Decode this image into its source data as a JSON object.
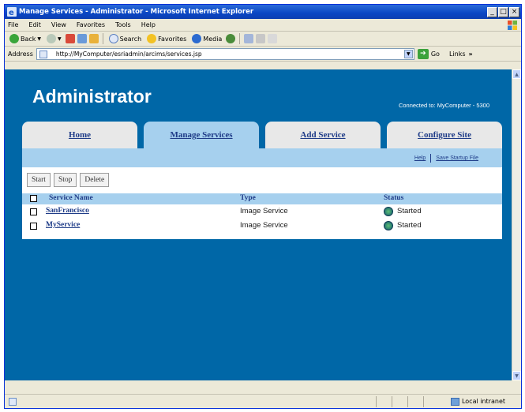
{
  "window": {
    "title": "Manage Services - Administrator - Microsoft Internet Explorer",
    "buttons": {
      "minimize": "_",
      "maximize": "□",
      "close": "×"
    }
  },
  "menu": [
    "File",
    "Edit",
    "View",
    "Favorites",
    "Tools",
    "Help"
  ],
  "toolbar": {
    "back": "Back",
    "search": "Search",
    "favorites": "Favorites",
    "media": "Media"
  },
  "address": {
    "label": "Address",
    "url": "http://MyComputer/esriadmin/arcims/services.jsp",
    "go": "Go",
    "links": "Links"
  },
  "page": {
    "title": "Administrator",
    "connected": "Connected to: MyComputer - 5300",
    "tabs": [
      "Home",
      "Manage Services",
      "Add Service",
      "Configure Site"
    ],
    "active_tab": "Manage Services",
    "sublinks": {
      "help": "Help",
      "save": "Save Startup File"
    },
    "actions": [
      "Start",
      "Stop",
      "Delete"
    ],
    "columns": {
      "name": "Service Name",
      "type": "Type",
      "status": "Status"
    },
    "services": [
      {
        "name": "SanFrancisco",
        "type": "Image Service",
        "status": "Started"
      },
      {
        "name": "MyService",
        "type": "Image Service",
        "status": "Started"
      }
    ]
  },
  "statusbar": {
    "zone": "Local intranet"
  },
  "colors": {
    "page_bg": "#0067a7",
    "tab_active": "#a6d0ee",
    "link": "#1f3c88"
  }
}
